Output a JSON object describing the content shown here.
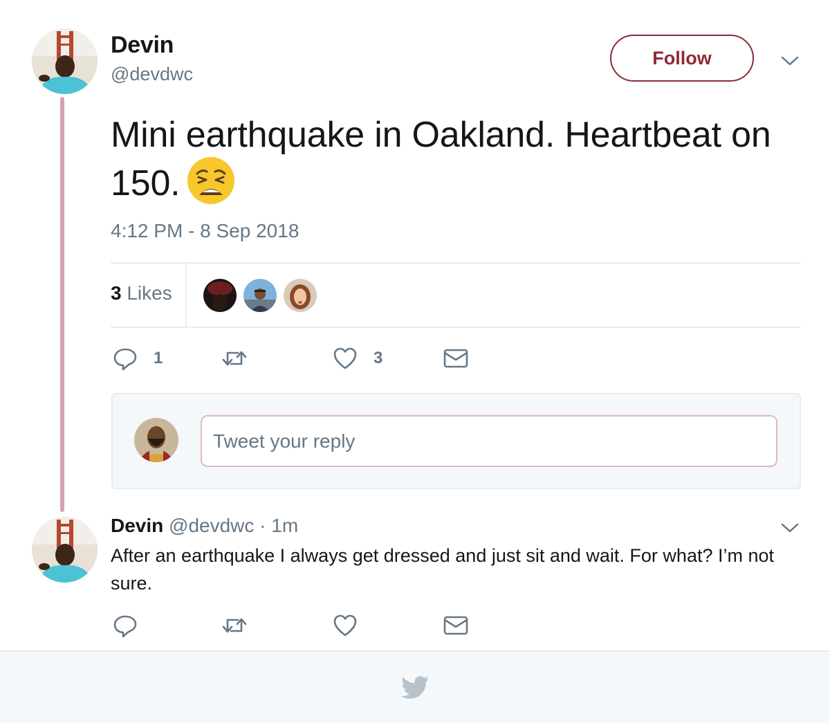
{
  "tweet": {
    "author_name": "Devin",
    "author_handle": "@devdwc",
    "follow_label": "Follow",
    "text": "Mini earthquake in Oakland. Heartbeat on 150.",
    "emoji": "weary-face",
    "timestamp": "4:12 PM - 8 Sep 2018",
    "likes_count": "3",
    "likes_label": "Likes",
    "actions": {
      "reply_count": "1",
      "like_count": "3"
    }
  },
  "reply_composer": {
    "placeholder": "Tweet your reply"
  },
  "reply_tweet": {
    "author_name": "Devin",
    "author_handle": "@devdwc",
    "time": "· 1m",
    "text": "After an earthquake I always get dressed and just sit and wait. For what? I’m not sure."
  },
  "colors": {
    "accent": "#8e2a36",
    "thread_line": "#d4a3ad",
    "muted_text": "#657786"
  }
}
